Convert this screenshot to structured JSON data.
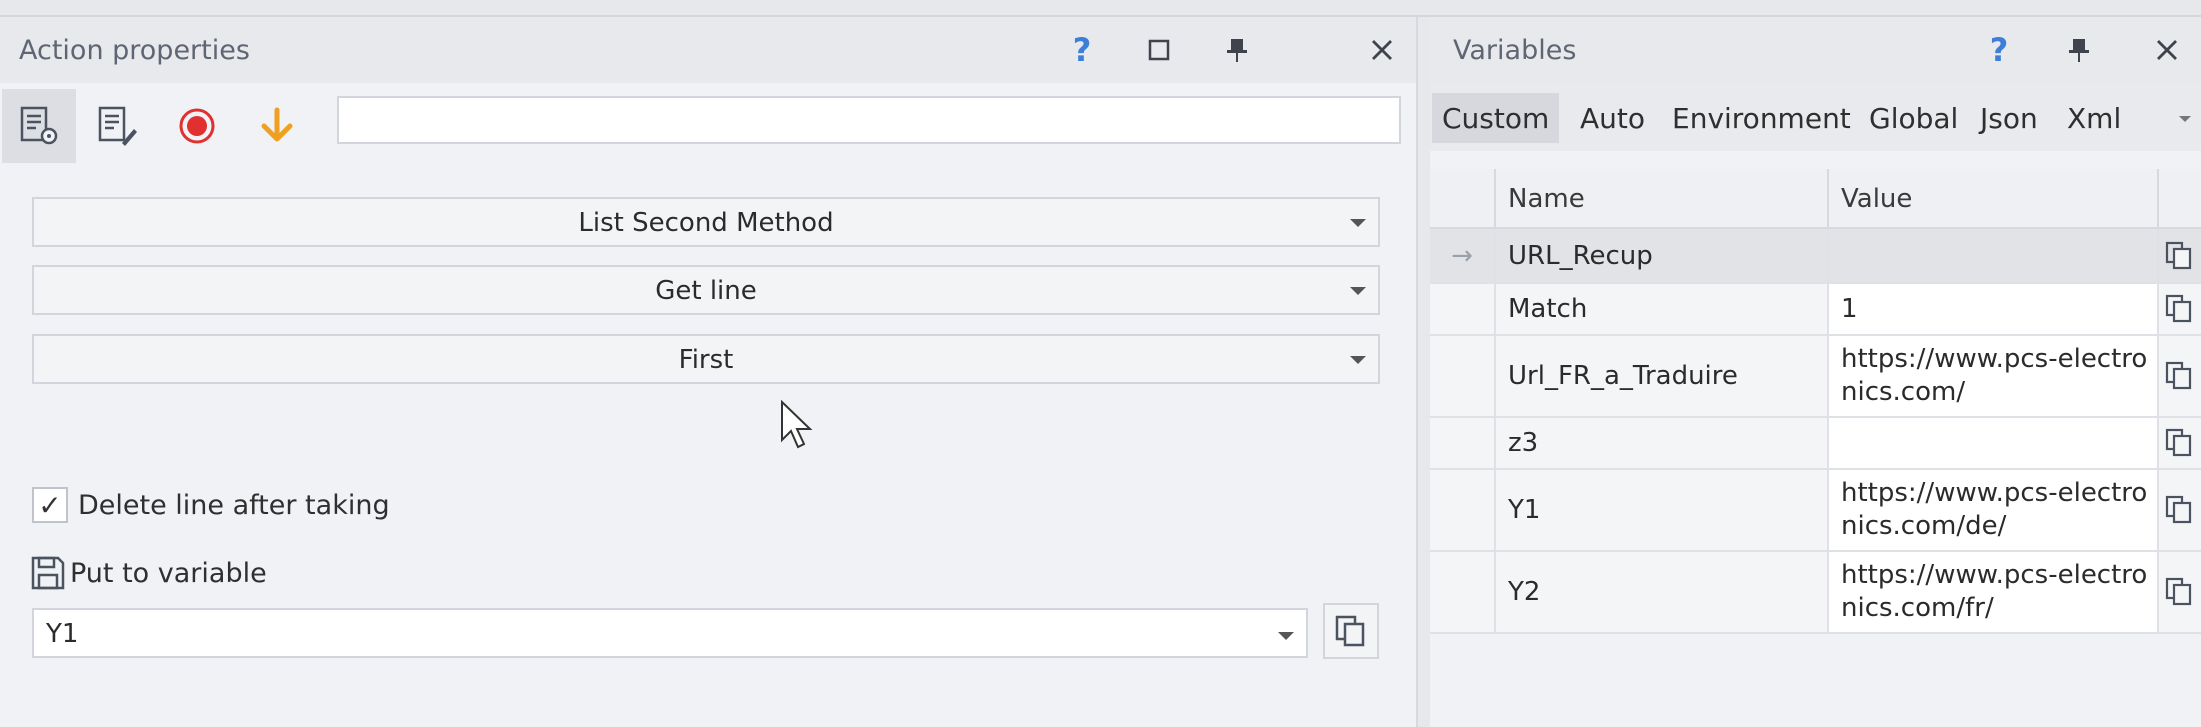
{
  "action_panel": {
    "title": "Action properties",
    "help_label": "?",
    "search_value": "",
    "dropdown_1": "List Second Method",
    "dropdown_2": "Get line",
    "dropdown_3": "First",
    "checkbox_label": "Delete line after taking",
    "checkbox_checked": true,
    "checkbox_mark": "✓",
    "put_to_variable_label": "Put to variable",
    "variable_value": "Y1"
  },
  "variables_panel": {
    "title": "Variables",
    "help_label": "?",
    "tabs": [
      "Custom",
      "Auto",
      "Environment",
      "Global",
      "Json",
      "Xml"
    ],
    "active_tab": "Custom",
    "columns": {
      "name": "Name",
      "value": "Value"
    },
    "current_row_indicator": "→",
    "rows": [
      {
        "name": "URL_Recup",
        "value": ""
      },
      {
        "name": "Match",
        "value": "1"
      },
      {
        "name": "Url_FR_a_Traduire",
        "value": "https://www.pcs-electronics.com/"
      },
      {
        "name": "z3",
        "value": ""
      },
      {
        "name": "Y1",
        "value": "https://www.pcs-electronics.com/de/"
      },
      {
        "name": "Y2",
        "value": "https://www.pcs-electronics.com/fr/"
      }
    ]
  },
  "colors": {
    "accent_blue": "#3d7fd8",
    "record_red": "#e0302f",
    "arrow_orange": "#f0a020",
    "panel_bg": "#f1f2f5"
  }
}
